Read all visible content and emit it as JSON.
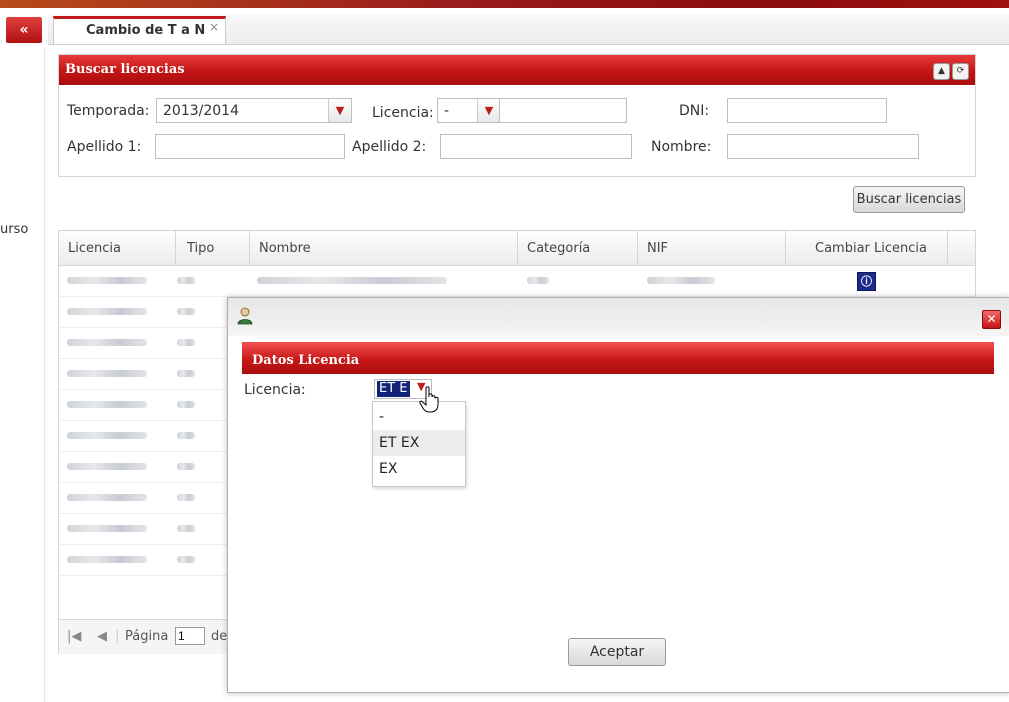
{
  "tab": {
    "label": "Cambio de T a N",
    "close": "×"
  },
  "side_text": "urso",
  "search_panel": {
    "title": "Buscar licencias",
    "temporada_label": "Temporada:",
    "temporada_value": "2013/2014",
    "licencia_label": "Licencia:",
    "licencia_value": "-",
    "dni_label": "DNI:",
    "apellido1_label": "Apellido 1:",
    "apellido2_label": "Apellido 2:",
    "nombre_label": "Nombre:",
    "search_button": "Buscar licencias"
  },
  "grid": {
    "columns": [
      "Licencia",
      "Tipo",
      "Nombre",
      "Categoría",
      "NIF",
      "Cambiar Licencia"
    ],
    "pager_label": "Página",
    "pager_value": "1",
    "pager_of": "de"
  },
  "modal": {
    "section_title": "Datos Licencia",
    "licencia_label": "Licencia:",
    "selected_value": "ET E",
    "options": [
      "-",
      "ET EX",
      "EX"
    ],
    "accept_button": "Aceptar"
  },
  "colors": {
    "accent_red": "#c41515",
    "info_icon_blue": "#1c2a8c"
  }
}
